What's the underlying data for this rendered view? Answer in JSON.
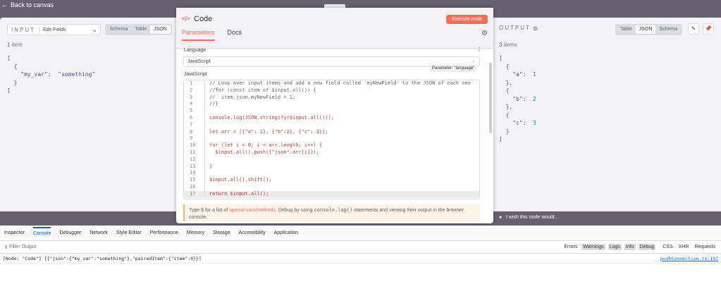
{
  "back_label": "Back to canvas",
  "input": {
    "title": "INPUT",
    "node": "Edit Fields",
    "views": [
      "Schema",
      "Table",
      "JSON"
    ],
    "active": "JSON",
    "count": "1 item",
    "key": "\"my_var\"",
    "value": "\"something\""
  },
  "output": {
    "title": "OUTPUT",
    "views": [
      "Table",
      "JSON",
      "Schema"
    ],
    "active": "JSON",
    "count": "3 items",
    "items": [
      {
        "k": "\"a\"",
        "v": "1"
      },
      {
        "k": "\"b\"",
        "v": "2"
      },
      {
        "k": "\"c\"",
        "v": "3"
      }
    ]
  },
  "modal": {
    "title": "Code",
    "execute": "Execute node",
    "tabs": [
      "Parameters",
      "Docs"
    ],
    "language_label": "Language",
    "language": "JavaScript",
    "tooltip": "Parameter: \"language\"",
    "code_label": "JavaScript",
    "code": [
      "// Loop over input items and add a new field called 'myNewField' to the JSON of each one",
      "//for (const item of $input.all()) {",
      "//  item.json.myNewField = 1;",
      "//}",
      "",
      "console.log(JSON.stringify($input.all()));",
      "",
      "let arr = [{\"a\": 1}, {\"b\":2}, {\"c\": 3}];",
      "",
      "for (let i = 0; i < arr.length; i++) {",
      "  $input.all().push({\"json\":arr[i]});",
      "",
      "}",
      "",
      "$input.all().shift();",
      "",
      "return $input.all();"
    ],
    "hint_pre": "Type $ for a list of ",
    "hint_link": "special vars/methods",
    "hint_mid": ". Debug by using ",
    "hint_code": "console.log()",
    "hint_post": " statements and viewing their output in the browser console."
  },
  "feedback": "I wish this node would...",
  "devtools": {
    "tabs": [
      "Inspector",
      "Console",
      "Debugger",
      "Network",
      "Style Editor",
      "Performance",
      "Memory",
      "Storage",
      "Accessibility",
      "Application"
    ],
    "active": "Console",
    "filter_placeholder": "Filter Output",
    "levels": [
      "Errors",
      "Warnings",
      "Logs",
      "Info",
      "Debug"
    ],
    "extra": [
      "CSS",
      "XHR",
      "Requests"
    ],
    "message": "[Node: \"Code\"] [{\"json\":{\"my_var\":\"something\"},\"pairedItem\":{\"item\":0}}]",
    "source": "pushConnection.ts:197"
  },
  "colors": {
    "accent": "#ff6d5a",
    "canvas": "#65616f"
  }
}
